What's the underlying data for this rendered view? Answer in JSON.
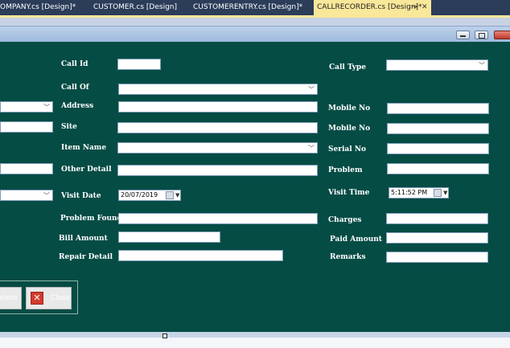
{
  "tabs": [
    {
      "label": "OMPANY.cs [Design]*"
    },
    {
      "label": "CUSTOMER.cs [Design]"
    },
    {
      "label": "CUSTOMERENTRY.cs [Design]*"
    },
    {
      "label": "CALLRECORDER.cs [Design]*",
      "active": true
    }
  ],
  "window_controls": {
    "minimize": "minimize-icon",
    "maximize": "maximize-icon",
    "close": "close-icon"
  },
  "colors": {
    "form_bg": "#054c45",
    "active_tab": "#f9e79a",
    "tabbar": "#2c3d5a"
  },
  "form": {
    "call_id": {
      "label": "Call Id",
      "value": ""
    },
    "call_of": {
      "label": "Call Of",
      "value": ""
    },
    "address": {
      "label": "Address",
      "value": ""
    },
    "site": {
      "label": "Site",
      "value": ""
    },
    "item_name": {
      "label": "Item Name",
      "value": ""
    },
    "other_detail": {
      "label": "Other Detail",
      "value": ""
    },
    "visit_date": {
      "label": "Visit Date",
      "value": "20/07/2019"
    },
    "problem_found": {
      "label": "Problem Found",
      "value": ""
    },
    "bill_amount": {
      "label": "Bill Amount",
      "value": ""
    },
    "repair_detail": {
      "label": "Repair Detail",
      "value": ""
    },
    "call_type": {
      "label": "Call Type",
      "value": ""
    },
    "mobile_no_1": {
      "label": "Mobile No",
      "value": ""
    },
    "mobile_no_2": {
      "label": "Mobile No",
      "value": ""
    },
    "serial_no": {
      "label": "Serial No",
      "value": ""
    },
    "problem": {
      "label": "Problem",
      "value": ""
    },
    "visit_time": {
      "label": "Visit Time",
      "value": "5:11:52 PM"
    },
    "charges": {
      "label": "Charges",
      "value": ""
    },
    "paid_amount": {
      "label": "Paid Amount",
      "value": ""
    },
    "remarks": {
      "label": "Remarks",
      "value": ""
    }
  },
  "buttons": {
    "delete": "elete",
    "close": "Close"
  }
}
